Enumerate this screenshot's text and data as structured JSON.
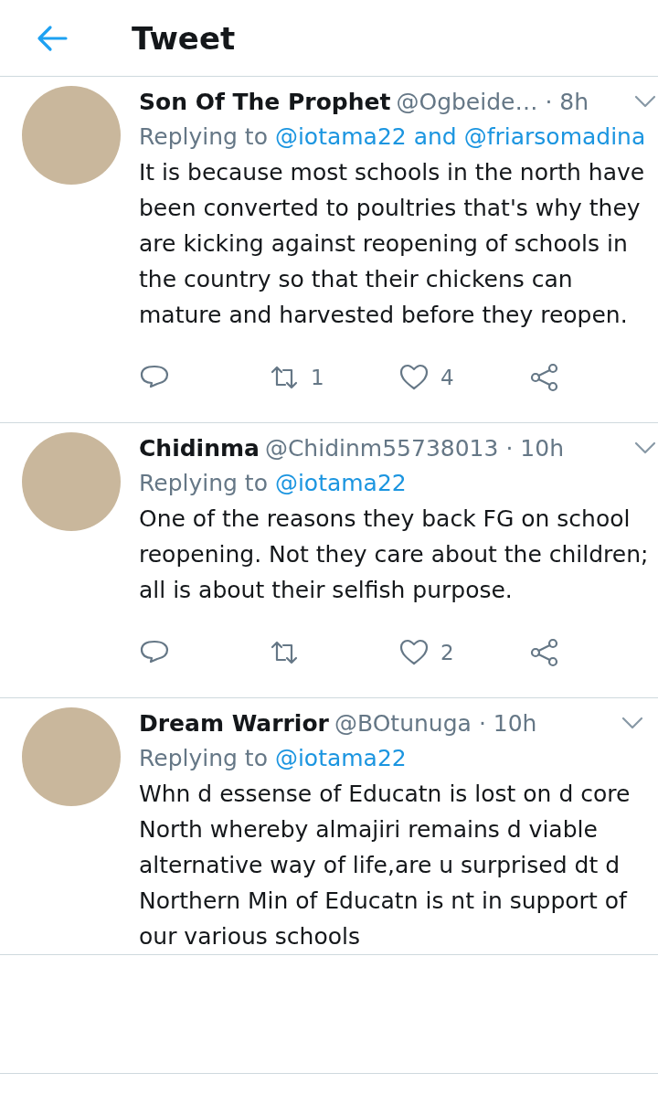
{
  "header": {
    "title": "Tweet"
  },
  "tweets": [
    {
      "name": "Son Of The Prophet",
      "handle": "@Ogbeide…",
      "time": "· 8h",
      "replying_label": "Replying to",
      "replying_to": "@iotama22 and @friarsomadina",
      "text": "It is because most schools in the north have been converted to poultries that's why they are kicking against reopening of schools in the country so that their chickens can mature and harvested before they reopen.",
      "actions": {
        "retweets": "1",
        "likes": "4"
      }
    },
    {
      "name": "Chidinma",
      "handle": "@Chidinm55738013",
      "time": "· 10h",
      "replying_label": "Replying to",
      "replying_to": "@iotama22",
      "text": "One of the reasons they  back FG  on school reopening. Not they care about the children; all is about their selfish purpose.",
      "actions": {
        "likes": "2"
      }
    },
    {
      "name": "Dream Warrior",
      "handle": "@BOtunuga",
      "time": "· 10h",
      "replying_label": "Replying to",
      "replying_to": "@iotama22",
      "text": "Whn d essense of Educatn is lost on d core North whereby almajiri remains d viable alternative way of life,are u surprised dt d Northern Min of Educatn is nt in support of our various schools"
    }
  ]
}
